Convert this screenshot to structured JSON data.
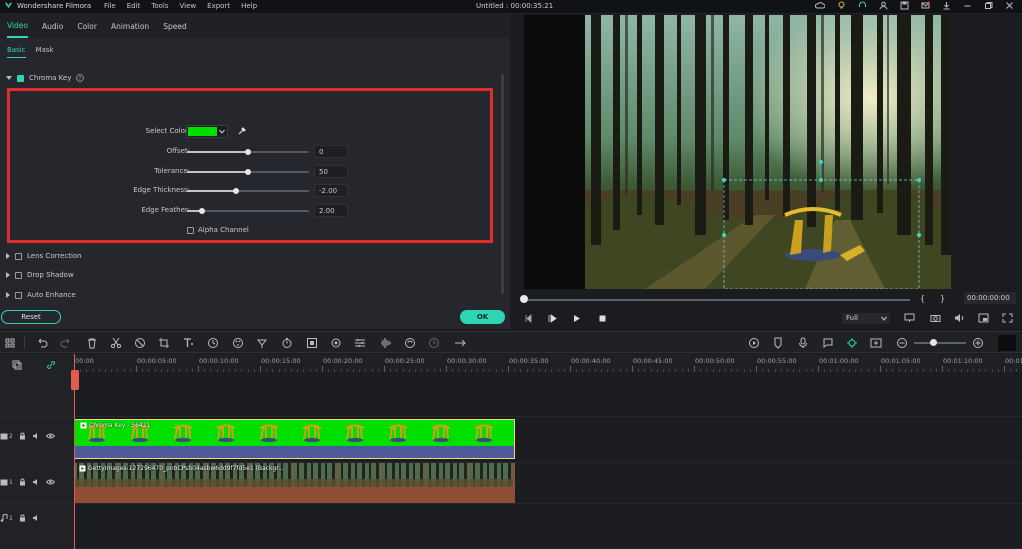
{
  "app": {
    "name": "Wondershare Filmora",
    "menu": [
      "File",
      "Edit",
      "Tools",
      "View",
      "Export",
      "Help"
    ],
    "title": "Untitled : 00:00:35:21"
  },
  "editor": {
    "tabs": [
      "Video",
      "Audio",
      "Color",
      "Animation",
      "Speed"
    ],
    "subtabs": [
      "Basic",
      "Mask"
    ],
    "chroma_key": {
      "label": "Chroma Key",
      "enabled": true,
      "select_color_label": "Select Color:",
      "select_color_value": "#00e000",
      "alpha_channel_label": "Alpha Channel",
      "params": [
        {
          "label": "Offset:",
          "value": "0",
          "level": 0.5
        },
        {
          "label": "Tolerance:",
          "value": "50",
          "level": 0.5
        },
        {
          "label": "Edge Thickness:",
          "value": "-2.00",
          "level": 0.4
        },
        {
          "label": "Edge Feather:",
          "value": "2.00",
          "level": 0.12
        }
      ]
    },
    "sections": [
      "Lens Correction",
      "Drop Shadow",
      "Auto Enhance"
    ],
    "reset_label": "Reset",
    "ok_label": "OK"
  },
  "preview": {
    "timecode": "00:00:00:00",
    "quality": "Full",
    "progress": 0
  },
  "timeline": {
    "ruler_labels": [
      "00:00",
      "00:00:05:00",
      "00:00:10:00",
      "00:00:15:00",
      "00:00:20:00",
      "00:00:25:00",
      "00:00:30:00",
      "00:00:35:00",
      "00:00:40:00",
      "00:00:45:00",
      "00:00:50:00",
      "00:00:55:00",
      "00:01:00:00",
      "00:01:05:00",
      "00:01:10:00",
      "00:01:15:00"
    ],
    "clip_chroma": "Chroma Key - 56421",
    "clip_background": "GettyImages-127296470_pnbCPsb04asbw6dd9f7fd5e1 (Backgr...",
    "tracks": [
      "2",
      "1",
      "1"
    ]
  },
  "colors": {
    "accent": "#2fd6b6",
    "highlight": "#e22b2b",
    "green_screen": "#00e000",
    "playhead": "#e35a4f"
  }
}
